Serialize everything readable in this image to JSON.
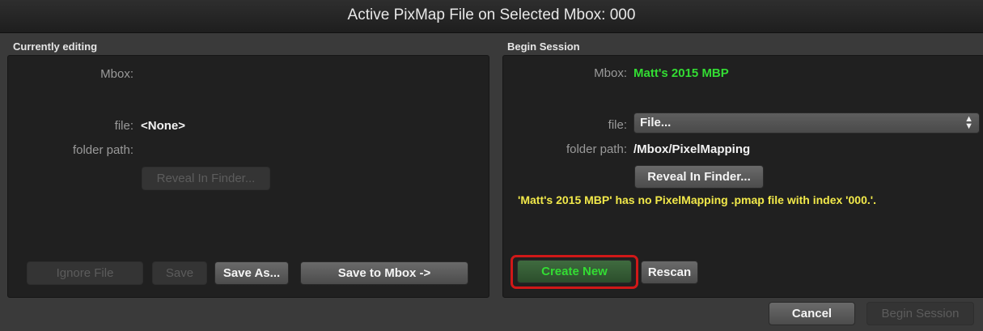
{
  "window": {
    "title": "Active PixMap File on Selected Mbox: 000"
  },
  "left_panel": {
    "label": "Currently editing",
    "mbox_label": "Mbox:",
    "mbox_value": "",
    "file_label": "file:",
    "file_value": "<None>",
    "folder_label": "folder path:",
    "folder_value": "",
    "reveal_button": "Reveal In Finder...",
    "ignore_button": "Ignore File",
    "save_button": "Save",
    "save_as_button": "Save As...",
    "save_to_mbox_button": "Save to Mbox ->"
  },
  "right_panel": {
    "label": "Begin Session",
    "mbox_label": "Mbox:",
    "mbox_value": "Matt's 2015 MBP",
    "file_label": "file:",
    "file_select_value": "File...",
    "folder_label": "folder path:",
    "folder_value": "/Mbox/PixelMapping",
    "reveal_button": "Reveal In Finder...",
    "warning": "'Matt's 2015 MBP' has no PixelMapping .pmap file with index '000.'.",
    "create_new_button": "Create New",
    "rescan_button": "Rescan"
  },
  "footer": {
    "cancel_button": "Cancel",
    "begin_session_button": "Begin Session"
  },
  "colors": {
    "accent_green": "#33dd33",
    "warning_yellow": "#f2e94a",
    "highlight_red": "#d01818"
  },
  "icons": {
    "select_chevron": "updown-chevron-icon"
  }
}
